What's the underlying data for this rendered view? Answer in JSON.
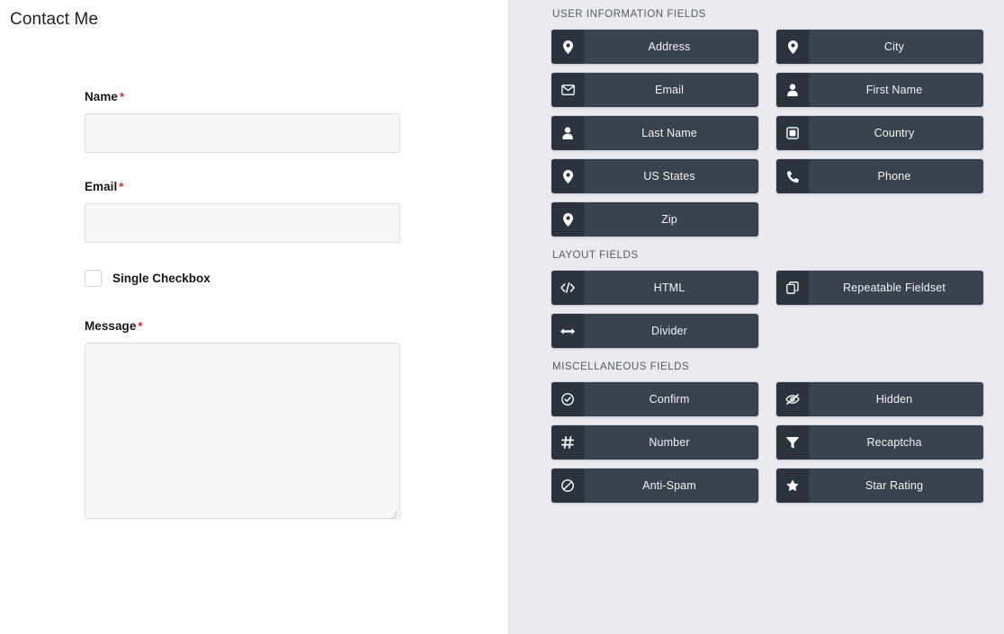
{
  "form": {
    "title": "Contact Me",
    "fields": [
      {
        "type": "text",
        "label": "Name",
        "required_marker": "*",
        "value": "",
        "placeholder": "",
        "name": "name"
      },
      {
        "type": "text",
        "label": "Email",
        "required_marker": "*",
        "value": "",
        "placeholder": "",
        "name": "email"
      },
      {
        "type": "checkbox",
        "label": "Single Checkbox",
        "checked": false,
        "name": "single-checkbox"
      },
      {
        "type": "textarea",
        "label": "Message",
        "required_marker": "*",
        "value": "",
        "placeholder": "",
        "name": "message"
      }
    ]
  },
  "panel": {
    "background_color": "#eaeaef",
    "button_color": "#39434d",
    "button_icon_color": "#2b333c",
    "required_star_color": "#ec1c24",
    "sections": [
      {
        "title": "USER INFORMATION FIELDS",
        "buttons": [
          {
            "label": "Address",
            "icon": "map-pin-icon"
          },
          {
            "label": "City",
            "icon": "map-pin-icon"
          },
          {
            "label": "Email",
            "icon": "envelope-icon"
          },
          {
            "label": "First Name",
            "icon": "user-icon"
          },
          {
            "label": "Last Name",
            "icon": "user-icon"
          },
          {
            "label": "Country",
            "icon": "square-icon"
          },
          {
            "label": "US States",
            "icon": "map-pin-icon"
          },
          {
            "label": "Phone",
            "icon": "phone-icon"
          },
          {
            "label": "Zip",
            "icon": "map-pin-icon"
          }
        ]
      },
      {
        "title": "LAYOUT FIELDS",
        "buttons": [
          {
            "label": "HTML",
            "icon": "code-icon"
          },
          {
            "label": "Repeatable Fieldset",
            "icon": "copy-icon"
          },
          {
            "label": "Divider",
            "icon": "arrows-horizontal-icon"
          }
        ]
      },
      {
        "title": "MISCELLANEOUS FIELDS",
        "buttons": [
          {
            "label": "Confirm",
            "icon": "check-circle-icon"
          },
          {
            "label": "Hidden",
            "icon": "eye-slash-icon"
          },
          {
            "label": "Number",
            "icon": "hashtag-icon"
          },
          {
            "label": "Recaptcha",
            "icon": "funnel-icon"
          },
          {
            "label": "Anti-Spam",
            "icon": "ban-icon"
          },
          {
            "label": "Star Rating",
            "icon": "star-half-icon"
          }
        ]
      }
    ]
  }
}
